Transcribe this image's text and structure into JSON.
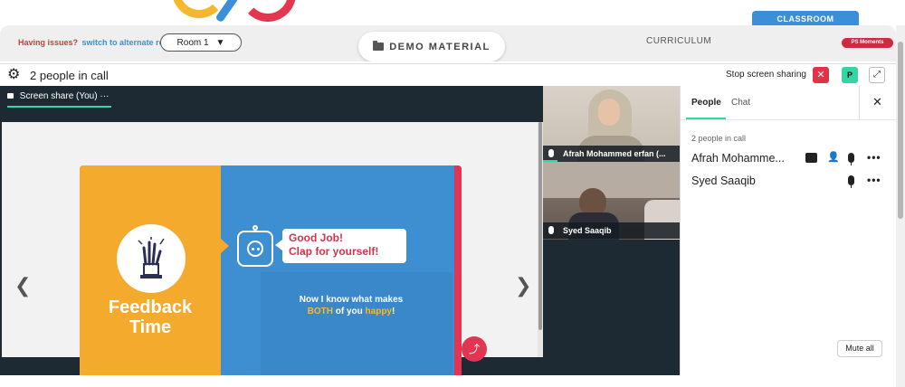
{
  "header": {
    "issues_text": "Having issues?",
    "alt_room_text": "switch to alternate room",
    "room_select": "Room 1",
    "demo_material_label": "DEMO MATERIAL",
    "curriculum_label": "CURRICULUM",
    "classroom_label": "CLASSROOM",
    "moments_label": "PS Moments"
  },
  "callbar": {
    "title": "2 people in call",
    "stop_share_label": "Stop screen sharing",
    "avatar_letter": "P"
  },
  "stage": {
    "share_tab_label": "Screen share (You)",
    "slide": {
      "left_title_line1": "Feedback",
      "left_title_line2": "Time",
      "bubble_line1": "Good Job!",
      "bubble_line2": "Clap for yourself!",
      "text_line1": "Now I know what makes",
      "text_both": "BOTH",
      "text_of_you": " of you ",
      "text_happy": "happy",
      "text_end": "!"
    }
  },
  "videos": [
    {
      "name": "Afrah Mohammed erfan (..."
    },
    {
      "name": "Syed Saaqib"
    }
  ],
  "panel": {
    "tab_people": "People",
    "tab_chat": "Chat",
    "count": "2 people in call",
    "people": [
      {
        "name": "Afrah Mohamme..."
      },
      {
        "name": "Syed Saaqib"
      }
    ],
    "mute_all_label": "Mute all"
  },
  "colors": {
    "accent_green": "#35d6a3",
    "brand_blue": "#3b8ed8",
    "alert_red": "#e23345",
    "slide_yellow": "#f4aa2d",
    "dark_stage": "#1e2a33"
  }
}
